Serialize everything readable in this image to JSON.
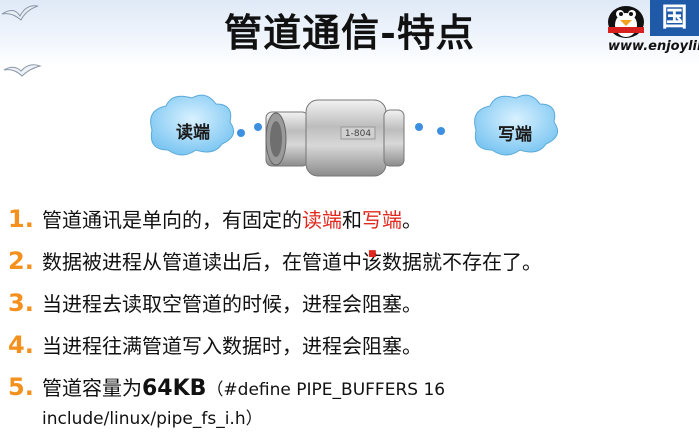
{
  "slide": {
    "title": "管道通信-特点",
    "website": "www.enjoylin",
    "brand_char": "国",
    "diagram": {
      "left_cloud_label": "读端",
      "right_cloud_label": "写端",
      "pipe_stamp": "1-804"
    },
    "items": [
      {
        "number": "1.",
        "text_before": "管道通讯是单向的，有固定的",
        "highlight1": "读端",
        "joiner": "和",
        "highlight2": "写端",
        "text_after": "。"
      },
      {
        "number": "2.",
        "text_before": "数据被进程从管道读出后，在管道中该",
        "marker": "■",
        "text_after": "数据就不存在了。"
      },
      {
        "number": "3.",
        "text": "当进程去读取空管道的时候，进程会阻塞。"
      },
      {
        "number": "4.",
        "text": "当进程往满管道写入数据时，进程会阻塞。"
      },
      {
        "number": "5.",
        "text_before": "管道容量为",
        "bold_text": "64KB",
        "text_after": "（#define PIPE_BUFFERS   16",
        "line2": "include/linux/pipe_fs_i.h）"
      }
    ]
  },
  "colors": {
    "accent_number": "#f4911e",
    "highlight_red": "#e0281e",
    "dot_blue": "#3d8fe0",
    "cloud_blue": "#8fd0f5"
  }
}
